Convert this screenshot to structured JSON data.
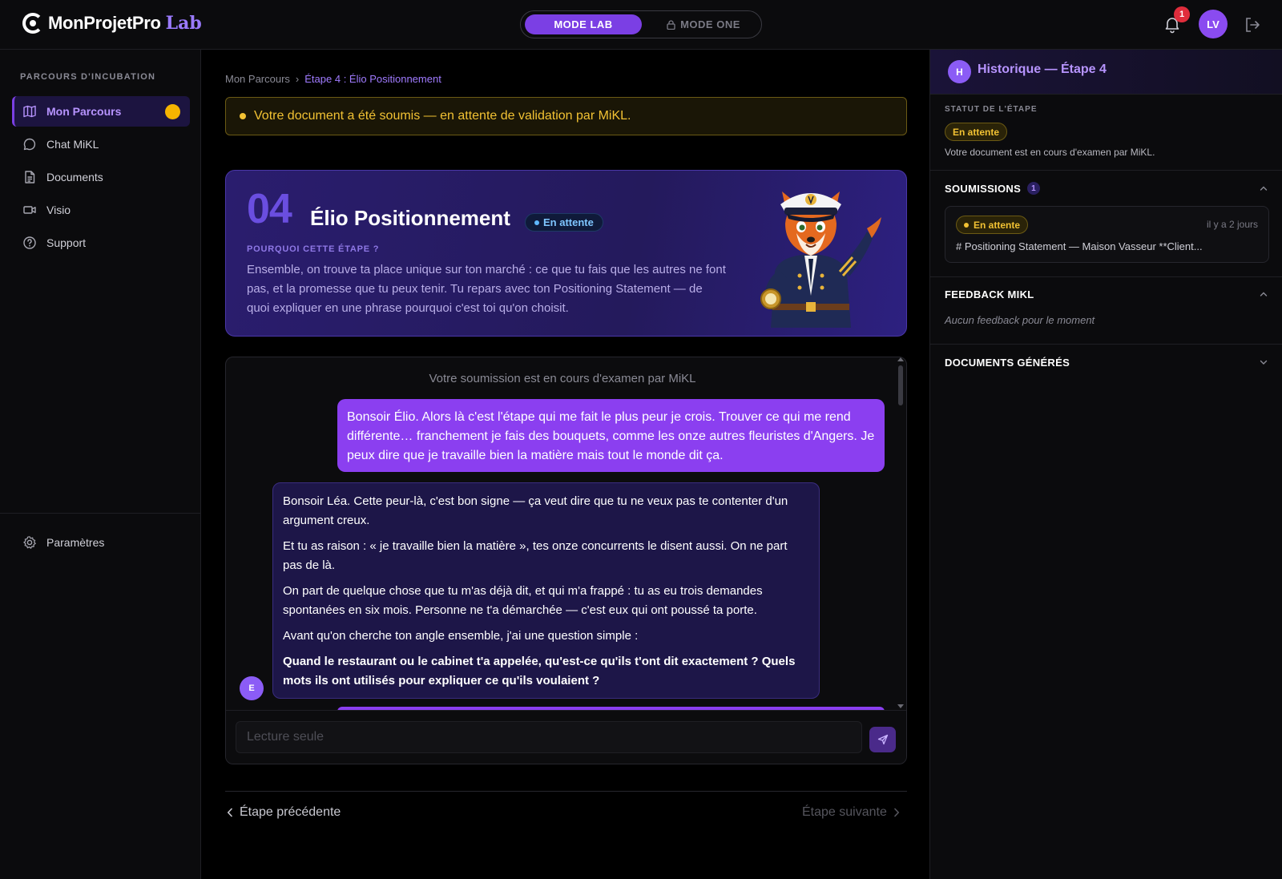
{
  "brand": {
    "name": "MonProjetPro",
    "suffix": "Lab"
  },
  "mode_switch": {
    "lab": "MODE LAB",
    "one": "MODE ONE"
  },
  "header": {
    "notifications": "1",
    "avatar_initials": "LV"
  },
  "sidebar": {
    "heading": "PARCOURS D'INCUBATION",
    "items": [
      {
        "label": "Mon Parcours",
        "icon": "map-icon"
      },
      {
        "label": "Chat MiKL",
        "icon": "chat-icon"
      },
      {
        "label": "Documents",
        "icon": "document-icon"
      },
      {
        "label": "Visio",
        "icon": "video-icon"
      },
      {
        "label": "Support",
        "icon": "help-icon"
      }
    ],
    "settings": "Paramètres"
  },
  "breadcrumb": {
    "root": "Mon Parcours",
    "separator": "›",
    "current": "Étape 4 : Élio Positionnement"
  },
  "alert": {
    "text": "Votre document a été soumis — en attente de validation par MiKL."
  },
  "step": {
    "number": "04",
    "title": "Élio Positionnement",
    "badge": "En attente",
    "why_label": "POURQUOI CETTE ÉTAPE ?",
    "why_text": "Ensemble, on trouve ta place unique sur ton marché : ce que tu fais que les autres ne font pas, et la promesse que tu peux tenir. Tu repars avec ton Positioning Statement — de quoi expliquer en une phrase pourquoi c'est toi qu'on choisit."
  },
  "chat": {
    "status": "Votre soumission est en cours d'examen par MiKL",
    "user_message": "Bonsoir Élio. Alors là c'est l'étape qui me fait le plus peur je crois. Trouver ce qui me rend différente… franchement je fais des bouquets, comme les onze autres fleuristes d'Angers. Je peux dire que je travaille bien la matière mais tout le monde dit ça.",
    "bot_paragraphs": [
      "Bonsoir Léa. Cette peur-là, c'est bon signe — ça veut dire que tu ne veux pas te contenter d'un argument creux.",
      "Et tu as raison : « je travaille bien la matière », tes onze concurrents le disent aussi. On ne part pas de là.",
      "On part de quelque chose que tu m'as déjà dit, et qui m'a frappé : tu as eu trois demandes spontanées en six mois. Personne ne t'a démarchée — c'est eux qui ont poussé ta porte.",
      "Avant qu'on cherche ton angle ensemble, j'ai une question simple :"
    ],
    "bot_question": "Quand le restaurant ou le cabinet t'a appelée, qu'est-ce qu'ils t'ont dit exactement ? Quels mots ils ont utilisés pour expliquer ce qu'ils voulaient ?",
    "bot_avatar": "E",
    "input_placeholder": "Lecture seule"
  },
  "nav": {
    "prev": "Étape précédente",
    "next": "Étape suivante"
  },
  "right_panel": {
    "avatar": "H",
    "title": "Historique — Étape 4",
    "status_label": "STATUT DE L'ÉTAPE",
    "status_badge": "En attente",
    "status_text": "Votre document est en cours d'examen par MiKL.",
    "submissions_title": "SOUMISSIONS",
    "submissions_count": "1",
    "submission": {
      "badge": "En attente",
      "time": "il y a 2 jours",
      "text": "# Positioning Statement — Maison Vasseur **Client..."
    },
    "feedback_title": "FEEDBACK MIKL",
    "feedback_empty": "Aucun feedback pour le moment",
    "docs_title": "DOCUMENTS GÉNÉRÉS"
  },
  "colors": {
    "accent": "#7b3fe4",
    "warning": "#f2c233",
    "user_bubble": "#8b3ff0",
    "info": "#5fb8ff"
  }
}
